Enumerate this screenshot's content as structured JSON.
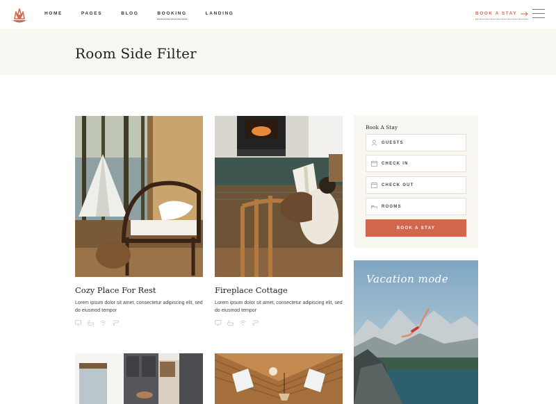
{
  "nav": {
    "items": [
      "HOME",
      "PAGES",
      "BLOG",
      "BOOKING",
      "LANDING"
    ],
    "active": "BOOKING",
    "book_link": "BOOK A STAY"
  },
  "page": {
    "title": "Room Side Filter"
  },
  "rooms": [
    {
      "title": "Cozy Place For Rest",
      "description": "Lorem ipsum dolor sit amet, consectetur adipiscing elit, sed do eiusmod tempor",
      "amenities": [
        "tv-icon",
        "bath-icon",
        "wifi-icon",
        "hairdryer-icon"
      ]
    },
    {
      "title": "Fireplace Cottage",
      "description": "Lorem ipsum dolor sit amet, consectetur adipiscing elit, sed do eiusmod tempor",
      "amenities": [
        "tv-icon",
        "bath-icon",
        "wifi-icon",
        "hairdryer-icon"
      ]
    }
  ],
  "widget": {
    "title": "Book A Stay",
    "fields": {
      "guests": "GUESTS",
      "check_in": "CHECK IN",
      "check_out": "CHECK OUT",
      "rooms": "ROOMS"
    },
    "button": "BOOK A STAY"
  },
  "banner": {
    "text": "Vacation mode"
  },
  "colors": {
    "accent": "#d2674d",
    "band": "#f9f7f1",
    "text": "#1f1f1f"
  }
}
